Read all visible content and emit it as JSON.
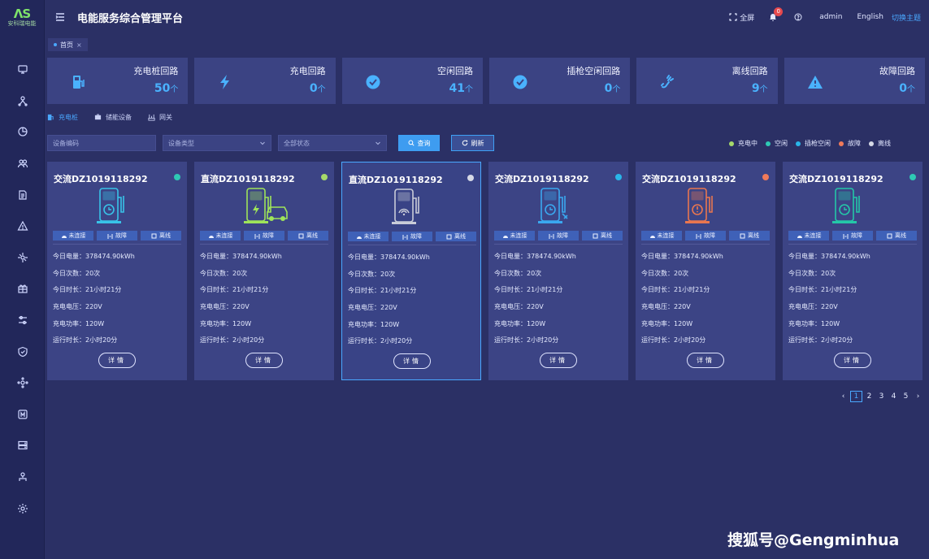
{
  "app": {
    "logo_mark": "ΛS",
    "logo_text": "安科瑞电能",
    "title": "电能服务综合管理平台"
  },
  "header": {
    "fullscreen": "全屏",
    "notification_count": "0",
    "user": "admin",
    "language": "English",
    "theme_switch": "切换主题"
  },
  "tabs": {
    "home": "首页",
    "close": "×"
  },
  "sidebar": {
    "icons": [
      "monitor-icon",
      "topology-icon",
      "pie-chart-icon",
      "users-icon",
      "document-icon",
      "alarm-icon",
      "network-icon",
      "gift-icon",
      "sliders-icon",
      "shield-icon",
      "nodes-icon",
      "meter-icon",
      "server-icon",
      "org-icon",
      "settings-icon"
    ]
  },
  "stats": [
    {
      "label": "充电桩回路",
      "value": "50",
      "unit": "个",
      "icon": "charging-pile-icon"
    },
    {
      "label": "充电回路",
      "value": "0",
      "unit": "个",
      "icon": "lightning-icon"
    },
    {
      "label": "空闲回路",
      "value": "41",
      "unit": "个",
      "icon": "check-circle-icon"
    },
    {
      "label": "插枪空闲回路",
      "value": "0",
      "unit": "个",
      "icon": "check-circle-icon"
    },
    {
      "label": "离线回路",
      "value": "9",
      "unit": "个",
      "icon": "unplugged-icon"
    },
    {
      "label": "故障回路",
      "value": "0",
      "unit": "个",
      "icon": "warning-icon"
    }
  ],
  "device_tabs": [
    {
      "label": "充电桩",
      "active": true
    },
    {
      "label": "储能设备",
      "active": false
    },
    {
      "label": "网关",
      "active": false
    }
  ],
  "filters": {
    "device_code_placeholder": "设备编码",
    "device_type_placeholder": "设备类型",
    "status_selected": "全部状态",
    "query": "查询",
    "refresh": "刷新"
  },
  "legend": [
    {
      "label": "充电中",
      "color": "#a6d96a"
    },
    {
      "label": "空闲",
      "color": "#2ec9b4"
    },
    {
      "label": "插枪空闲",
      "color": "#29b6e8"
    },
    {
      "label": "故障",
      "color": "#f07a5a"
    },
    {
      "label": "离线",
      "color": "#d6d9e6"
    }
  ],
  "chips": {
    "unconnected": "未连接",
    "fault": "故障",
    "offline": "离线"
  },
  "metric_labels": {
    "energy": "今日电量：",
    "count": "今日次数：",
    "duration": "今日时长：",
    "voltage": "充电电压：",
    "power": "充电功率：",
    "runtime": "运行时长："
  },
  "cards": [
    {
      "title": "交流DZ1019118292",
      "status_color": "#2ec9b4",
      "illus_color": "#38c3e8",
      "variant": "idle",
      "energy": "378474.90kWh",
      "count": "20次",
      "duration": "21小时21分",
      "voltage": "220V",
      "power": "120W",
      "runtime": "2小时20分",
      "detail": "详情"
    },
    {
      "title": "直流DZ1019118292",
      "status_color": "#a6d96a",
      "illus_color": "#9ee35a",
      "variant": "charging",
      "energy": "378474.90kWh",
      "count": "20次",
      "duration": "21小时21分",
      "voltage": "220V",
      "power": "120W",
      "runtime": "2小时20分",
      "detail": "详情"
    },
    {
      "title": "直流DZ1019118292",
      "status_color": "#d6d9e6",
      "illus_color": "#c9ccd8",
      "variant": "offline",
      "energy": "378474.90kWh",
      "count": "20次",
      "duration": "21小时21分",
      "voltage": "220V",
      "power": "120W",
      "runtime": "2小时20分",
      "detail": "详情"
    },
    {
      "title": "交流DZ1019118292",
      "status_color": "#29b6e8",
      "illus_color": "#3aa8f0",
      "variant": "plugged",
      "energy": "378474.90kWh",
      "count": "20次",
      "duration": "21小时21分",
      "voltage": "220V",
      "power": "120W",
      "runtime": "2小时20分",
      "detail": "详情"
    },
    {
      "title": "交流DZ1019118292",
      "status_color": "#f07a5a",
      "illus_color": "#e9764f",
      "variant": "fault",
      "energy": "378474.90kWh",
      "count": "20次",
      "duration": "21小时21分",
      "voltage": "220V",
      "power": "120W",
      "runtime": "2小时20分",
      "detail": "详情"
    },
    {
      "title": "交流DZ1019118292",
      "status_color": "#2ec9b4",
      "illus_color": "#24c7a8",
      "variant": "idle",
      "energy": "378474.90kWh",
      "count": "20次",
      "duration": "21小时21分",
      "voltage": "220V",
      "power": "120W",
      "runtime": "2小时20分",
      "detail": "详情"
    }
  ],
  "pagination": {
    "prev": "‹",
    "pages": [
      "1",
      "2",
      "3",
      "4",
      "5"
    ],
    "current": "1",
    "next": "›"
  },
  "watermark": "搜狐号@Gengminhua"
}
